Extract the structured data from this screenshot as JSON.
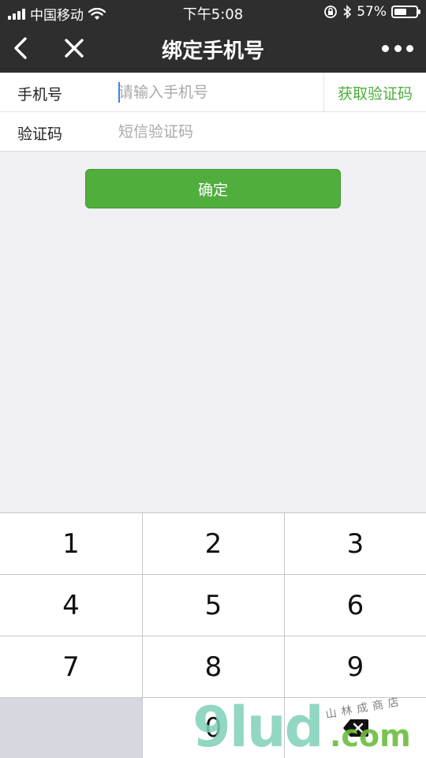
{
  "status": {
    "carrier": "中国移动",
    "time": "下午5:08",
    "battery_text": "57%",
    "battery_level": 0.57
  },
  "nav": {
    "title": "绑定手机号"
  },
  "form": {
    "phone_label": "手机号",
    "phone_placeholder": "请输入手机号",
    "phone_value": "",
    "get_code_label": "获取验证码",
    "code_label": "验证码",
    "code_placeholder": "短信验证码",
    "code_value": ""
  },
  "confirm_label": "确定",
  "keypad": {
    "keys": [
      "1",
      "2",
      "3",
      "4",
      "5",
      "6",
      "7",
      "8",
      "9",
      "0"
    ]
  },
  "watermark": {
    "text": "9lud",
    "suffix": ".com",
    "shop": "山林成商店"
  },
  "colors": {
    "accent_green": "#50ae3c",
    "link_green": "#4cae3a",
    "nav_bg": "#2e2e2f"
  }
}
